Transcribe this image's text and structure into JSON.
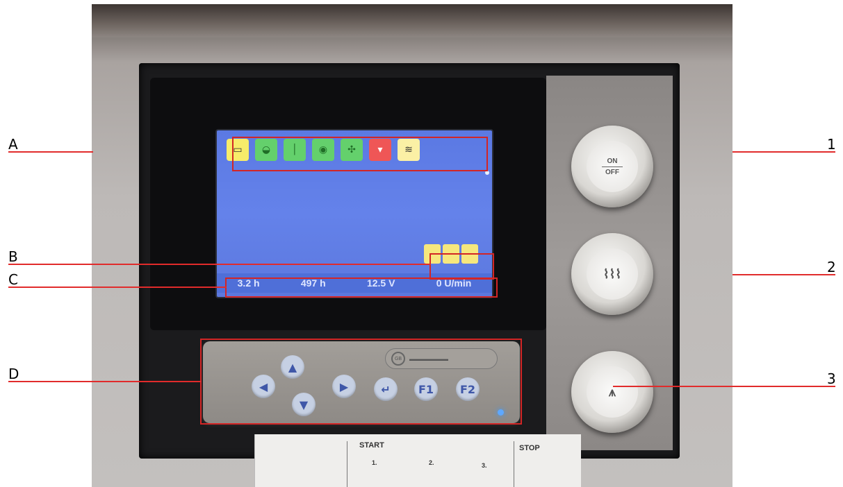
{
  "screen": {
    "status_bar": {
      "hours_1": "3.2 h",
      "hours_2": "497 h",
      "voltage": "12.5 V",
      "rpm": "0 U/min"
    }
  },
  "keypad": {
    "keys": {
      "left": "◀",
      "up": "▲",
      "down": "▼",
      "right": "▶",
      "enter": "↵",
      "f1": "F1",
      "f2": "F2"
    }
  },
  "buttons": {
    "on_off": {
      "on": "ON",
      "off": "OFF"
    }
  },
  "bottom_label": {
    "start": "START",
    "stop": "STOP",
    "step_1": "1.",
    "step_2": "2.",
    "step_3": "3."
  },
  "callouts": {
    "A": "A",
    "B": "B",
    "C": "C",
    "D": "D",
    "one": "1",
    "two": "2",
    "three": "3"
  },
  "colors": {
    "callout_line": "#e12b2b",
    "screen_bg": "#5b79e3",
    "status_ok": "#64d06c",
    "status_warn": "#f7ec6a",
    "status_alarm": "#ef5656"
  }
}
